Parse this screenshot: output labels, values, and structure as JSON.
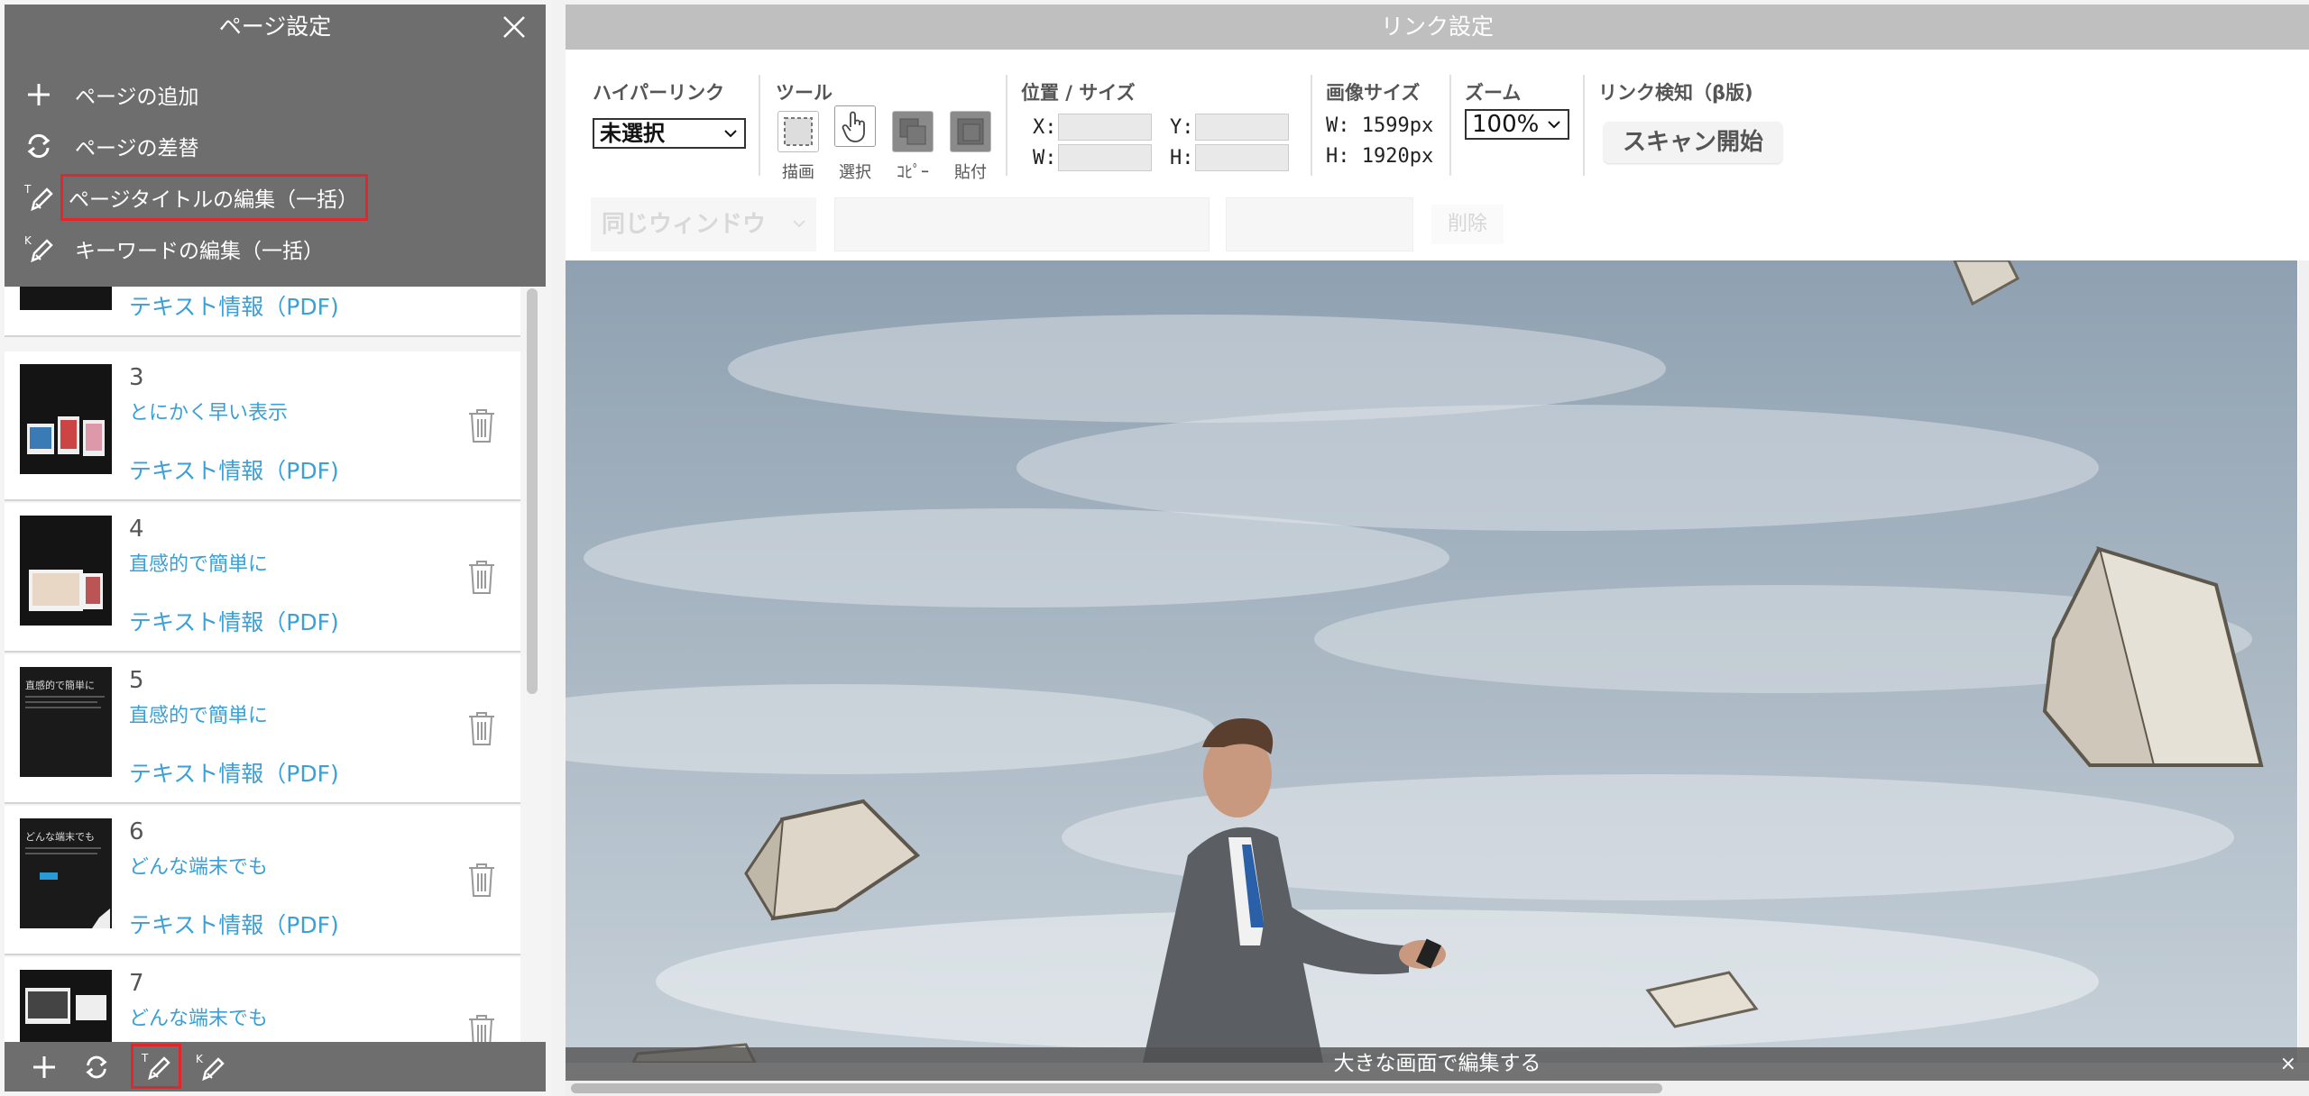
{
  "left_panel": {
    "title": "ページ設定",
    "menu": {
      "items": [
        {
          "label": "ページの追加",
          "icon": "plus-icon"
        },
        {
          "label": "ページの差替",
          "icon": "replace-icon"
        },
        {
          "label": "ページタイトルの編集（一括）",
          "icon": "title-edit-icon",
          "highlighted": true
        },
        {
          "label": "キーワードの編集（一括）",
          "icon": "keyword-edit-icon"
        }
      ]
    },
    "pages": [
      {
        "num": "",
        "title": "",
        "pdf": "テキスト情報（PDF)"
      },
      {
        "num": "3",
        "title": "とにかく早い表示",
        "pdf": "テキスト情報（PDF)"
      },
      {
        "num": "4",
        "title": "直感的で簡単に",
        "pdf": "テキスト情報（PDF)"
      },
      {
        "num": "5",
        "title": "直感的で簡単に",
        "pdf": "テキスト情報（PDF)"
      },
      {
        "num": "6",
        "title": "どんな端末でも",
        "pdf": "テキスト情報（PDF)"
      },
      {
        "num": "7",
        "title": "どんな端末でも",
        "pdf": ""
      }
    ],
    "thumb_texts": {
      "page5": "直感的で簡単に",
      "page6": "どんな端末でも"
    }
  },
  "right_panel": {
    "title": "リンク設定",
    "hyperlink": {
      "label": "ハイパーリンク",
      "value": "未選択"
    },
    "tools": {
      "label": "ツール",
      "items": [
        {
          "label": "描画",
          "icon": "draw-rect-icon"
        },
        {
          "label": "選択",
          "icon": "hand-select-icon",
          "active": true
        },
        {
          "label": "ｺﾋﾟｰ",
          "icon": "copy-icon"
        },
        {
          "label": "貼付",
          "icon": "paste-icon"
        }
      ]
    },
    "position": {
      "label": "位置 / サイズ",
      "x_label": "X:",
      "y_label": "Y:",
      "w_label": "W:",
      "h_label": "H:"
    },
    "image_size": {
      "label": "画像サイズ",
      "w": "W: 1599px",
      "h": "H: 1920px"
    },
    "zoom": {
      "label": "ズーム",
      "value": "100%"
    },
    "link_detect": {
      "label": "リンク検知（β版)",
      "button": "スキャン開始"
    },
    "sub": {
      "window_select": "同じウィンドウ",
      "delete": "削除"
    },
    "bottom_bar": {
      "label": "大きな画面で編集する",
      "close": "×"
    }
  },
  "colors": {
    "panel_gray": "#6e6e6e",
    "link_blue": "#3aa0d6",
    "highlight_red": "#e3262c"
  }
}
